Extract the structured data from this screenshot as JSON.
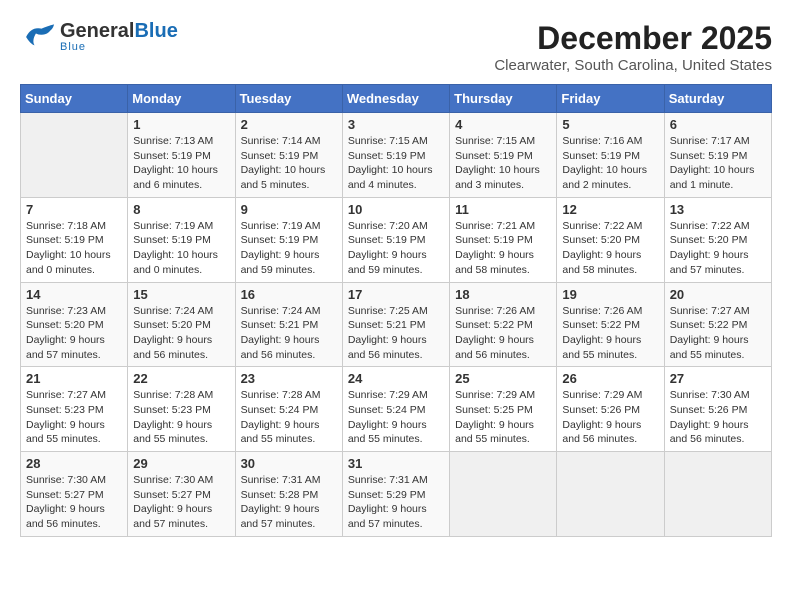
{
  "header": {
    "logo_general": "General",
    "logo_blue": "Blue",
    "logo_sub": "Blue",
    "month": "December 2025",
    "location": "Clearwater, South Carolina, United States"
  },
  "days_of_week": [
    "Sunday",
    "Monday",
    "Tuesday",
    "Wednesday",
    "Thursday",
    "Friday",
    "Saturday"
  ],
  "weeks": [
    [
      {
        "day": "",
        "info": ""
      },
      {
        "day": "1",
        "info": "Sunrise: 7:13 AM\nSunset: 5:19 PM\nDaylight: 10 hours\nand 6 minutes."
      },
      {
        "day": "2",
        "info": "Sunrise: 7:14 AM\nSunset: 5:19 PM\nDaylight: 10 hours\nand 5 minutes."
      },
      {
        "day": "3",
        "info": "Sunrise: 7:15 AM\nSunset: 5:19 PM\nDaylight: 10 hours\nand 4 minutes."
      },
      {
        "day": "4",
        "info": "Sunrise: 7:15 AM\nSunset: 5:19 PM\nDaylight: 10 hours\nand 3 minutes."
      },
      {
        "day": "5",
        "info": "Sunrise: 7:16 AM\nSunset: 5:19 PM\nDaylight: 10 hours\nand 2 minutes."
      },
      {
        "day": "6",
        "info": "Sunrise: 7:17 AM\nSunset: 5:19 PM\nDaylight: 10 hours\nand 1 minute."
      }
    ],
    [
      {
        "day": "7",
        "info": "Sunrise: 7:18 AM\nSunset: 5:19 PM\nDaylight: 10 hours\nand 0 minutes."
      },
      {
        "day": "8",
        "info": "Sunrise: 7:19 AM\nSunset: 5:19 PM\nDaylight: 10 hours\nand 0 minutes."
      },
      {
        "day": "9",
        "info": "Sunrise: 7:19 AM\nSunset: 5:19 PM\nDaylight: 9 hours\nand 59 minutes."
      },
      {
        "day": "10",
        "info": "Sunrise: 7:20 AM\nSunset: 5:19 PM\nDaylight: 9 hours\nand 59 minutes."
      },
      {
        "day": "11",
        "info": "Sunrise: 7:21 AM\nSunset: 5:19 PM\nDaylight: 9 hours\nand 58 minutes."
      },
      {
        "day": "12",
        "info": "Sunrise: 7:22 AM\nSunset: 5:20 PM\nDaylight: 9 hours\nand 58 minutes."
      },
      {
        "day": "13",
        "info": "Sunrise: 7:22 AM\nSunset: 5:20 PM\nDaylight: 9 hours\nand 57 minutes."
      }
    ],
    [
      {
        "day": "14",
        "info": "Sunrise: 7:23 AM\nSunset: 5:20 PM\nDaylight: 9 hours\nand 57 minutes."
      },
      {
        "day": "15",
        "info": "Sunrise: 7:24 AM\nSunset: 5:20 PM\nDaylight: 9 hours\nand 56 minutes."
      },
      {
        "day": "16",
        "info": "Sunrise: 7:24 AM\nSunset: 5:21 PM\nDaylight: 9 hours\nand 56 minutes."
      },
      {
        "day": "17",
        "info": "Sunrise: 7:25 AM\nSunset: 5:21 PM\nDaylight: 9 hours\nand 56 minutes."
      },
      {
        "day": "18",
        "info": "Sunrise: 7:26 AM\nSunset: 5:22 PM\nDaylight: 9 hours\nand 56 minutes."
      },
      {
        "day": "19",
        "info": "Sunrise: 7:26 AM\nSunset: 5:22 PM\nDaylight: 9 hours\nand 55 minutes."
      },
      {
        "day": "20",
        "info": "Sunrise: 7:27 AM\nSunset: 5:22 PM\nDaylight: 9 hours\nand 55 minutes."
      }
    ],
    [
      {
        "day": "21",
        "info": "Sunrise: 7:27 AM\nSunset: 5:23 PM\nDaylight: 9 hours\nand 55 minutes."
      },
      {
        "day": "22",
        "info": "Sunrise: 7:28 AM\nSunset: 5:23 PM\nDaylight: 9 hours\nand 55 minutes."
      },
      {
        "day": "23",
        "info": "Sunrise: 7:28 AM\nSunset: 5:24 PM\nDaylight: 9 hours\nand 55 minutes."
      },
      {
        "day": "24",
        "info": "Sunrise: 7:29 AM\nSunset: 5:24 PM\nDaylight: 9 hours\nand 55 minutes."
      },
      {
        "day": "25",
        "info": "Sunrise: 7:29 AM\nSunset: 5:25 PM\nDaylight: 9 hours\nand 55 minutes."
      },
      {
        "day": "26",
        "info": "Sunrise: 7:29 AM\nSunset: 5:26 PM\nDaylight: 9 hours\nand 56 minutes."
      },
      {
        "day": "27",
        "info": "Sunrise: 7:30 AM\nSunset: 5:26 PM\nDaylight: 9 hours\nand 56 minutes."
      }
    ],
    [
      {
        "day": "28",
        "info": "Sunrise: 7:30 AM\nSunset: 5:27 PM\nDaylight: 9 hours\nand 56 minutes."
      },
      {
        "day": "29",
        "info": "Sunrise: 7:30 AM\nSunset: 5:27 PM\nDaylight: 9 hours\nand 57 minutes."
      },
      {
        "day": "30",
        "info": "Sunrise: 7:31 AM\nSunset: 5:28 PM\nDaylight: 9 hours\nand 57 minutes."
      },
      {
        "day": "31",
        "info": "Sunrise: 7:31 AM\nSunset: 5:29 PM\nDaylight: 9 hours\nand 57 minutes."
      },
      {
        "day": "",
        "info": ""
      },
      {
        "day": "",
        "info": ""
      },
      {
        "day": "",
        "info": ""
      }
    ]
  ]
}
